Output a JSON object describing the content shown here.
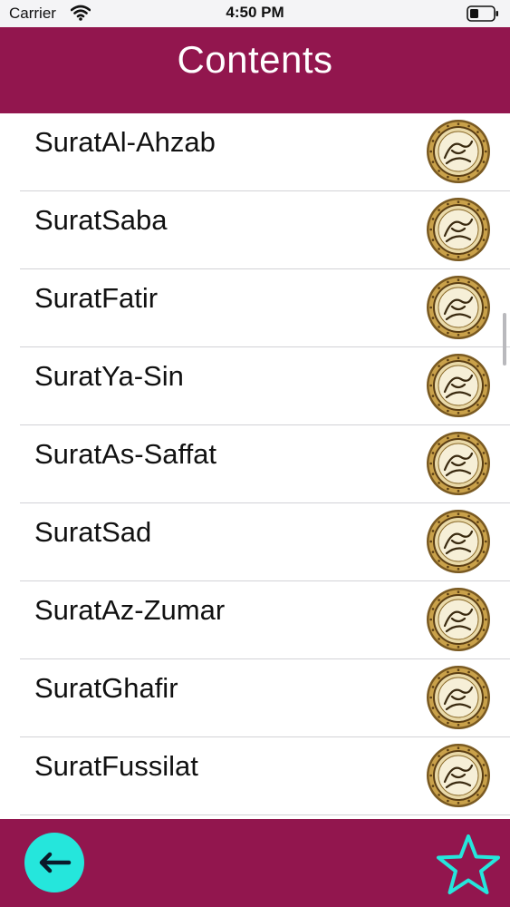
{
  "status_bar": {
    "carrier": "Carrier",
    "time": "4:50 PM"
  },
  "header": {
    "title": "Contents"
  },
  "list": {
    "items": [
      {
        "label": "SuratAl-Ahzab"
      },
      {
        "label": "SuratSaba"
      },
      {
        "label": "SuratFatir"
      },
      {
        "label": "SuratYa-Sin"
      },
      {
        "label": "SuratAs-Saffat"
      },
      {
        "label": "SuratSad"
      },
      {
        "label": "SuratAz-Zumar"
      },
      {
        "label": "SuratGhafir"
      },
      {
        "label": "SuratFussilat"
      }
    ],
    "item_icon": "quran-medallion-icon"
  },
  "bottom_bar": {
    "back_icon": "arrow-left-icon",
    "favorite_icon": "star-outline-icon"
  },
  "colors": {
    "brand": "#92164e",
    "accent": "#25e6dc",
    "medallion_gold": "#c9a14a"
  }
}
